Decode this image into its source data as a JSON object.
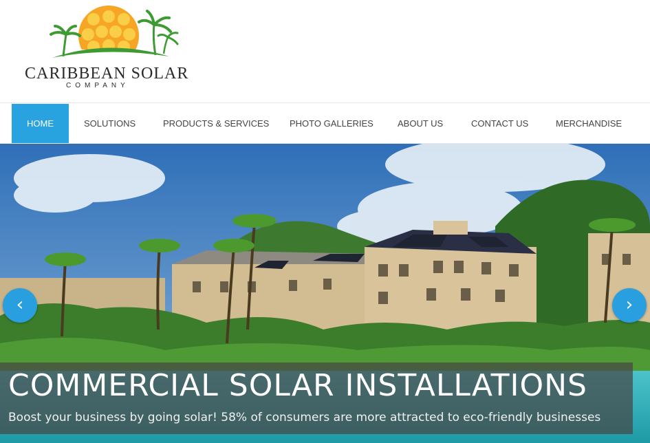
{
  "brand": {
    "name": "CARIBBEAN SOLAR",
    "subtitle": "COMPANY",
    "logo_icon": "sun-with-palms-logo",
    "colors": {
      "sun": "#f6a524",
      "palm": "#3e9b34"
    }
  },
  "nav": {
    "accent": "#29a3e0",
    "items": [
      {
        "label": "HOME",
        "active": true
      },
      {
        "label": "SOLUTIONS",
        "active": false
      },
      {
        "label": "PRODUCTS & SERVICES",
        "active": false
      },
      {
        "label": "PHOTO GALLERIES",
        "active": false
      },
      {
        "label": "ABOUT US",
        "active": false
      },
      {
        "label": "CONTACT US",
        "active": false
      },
      {
        "label": "MERCHANDISE",
        "active": false
      }
    ]
  },
  "slider": {
    "title": "COMMERCIAL SOLAR INSTALLATIONS",
    "subtitle": "Boost your business by going solar! 58% of consumers are more attracted to eco-friendly businesses",
    "prev_icon": "chevron-left-icon",
    "next_icon": "chevron-right-icon",
    "prev_glyph": "‹",
    "next_glyph": "›"
  }
}
